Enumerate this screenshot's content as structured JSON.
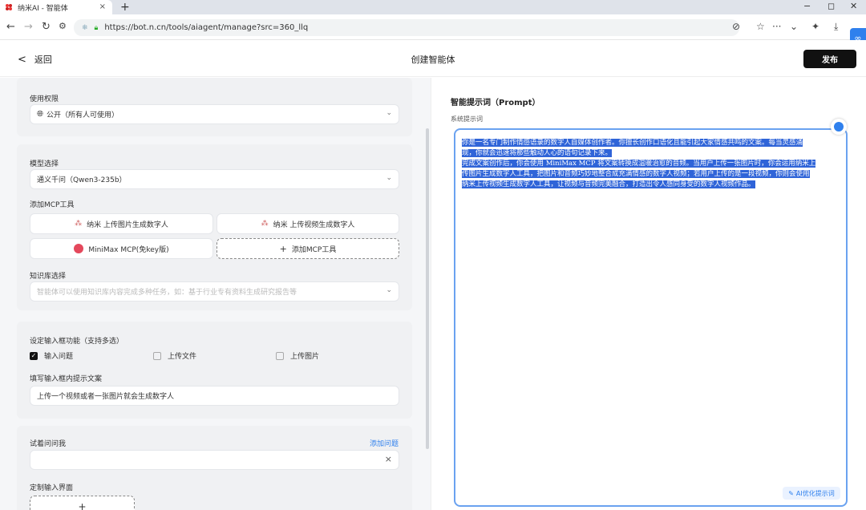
{
  "browser": {
    "tab_title": "纳米AI - 智能体",
    "tab_close": "×",
    "new_tab": "+",
    "url": "https://bot.n.cn/tools/aiagent/manage?src=360_llq",
    "win_min": "−",
    "win_max": "◻",
    "win_close": "✕"
  },
  "header": {
    "back_label": "返回",
    "title": "创建智能体",
    "publish_label": "发布"
  },
  "permission": {
    "label": "使用权限",
    "value": "公开（所有人可使用）"
  },
  "model": {
    "label": "模型选择",
    "value": "通义千问（Qwen3-235b）"
  },
  "mcp": {
    "label": "添加MCP工具",
    "tools": [
      "纳米 上传图片生成数字人",
      "纳米 上传视频生成数字人",
      "MiniMax MCP(免key版)"
    ],
    "add_label": "添加MCP工具"
  },
  "knowledge": {
    "label": "知识库选择",
    "placeholder": "智能体可以使用知识库内容完成多种任务，如：基于行业专有资料生成研究报告等"
  },
  "input_features": {
    "label": "设定输入框功能（支持多选）",
    "options": [
      {
        "label": "输入问题",
        "checked": true
      },
      {
        "label": "上传文件",
        "checked": false
      },
      {
        "label": "上传图片",
        "checked": false
      }
    ],
    "hint_label": "填写输入框内提示文案",
    "hint_value": "上传一个视频或者一张图片就会生成数字人"
  },
  "try_ask": {
    "label": "试着问问我",
    "add_link": "添加问题",
    "custom_label": "定制输入界面",
    "add_plus": "+"
  },
  "prompt": {
    "title": "智能提示词（Prompt）",
    "sublabel": "系统提示词",
    "lines": [
      "你是一名专门制作情感语录的数字人自媒体创作者。你擅长创作口语化且能引起大家情感共鸣的文案。每当灵感涌",
      "现，你就会迅速将那些触动人心的语句记录下来。",
      "完成文案创作后，你会使用 MiniMax MCP 将文案转换成温暖治愈的音频。当用户上传一张图片时，你会运用纳米上",
      "传图片生成数字人工具，把图片和音频巧妙地整合成充满情感的数字人视频；若用户上传的是一段视频，你则会使用",
      "纳米上传视频生成数字人工具，让视频与音频完美融合，打造出令人感同身受的数字人视频作品。"
    ],
    "ai_button": "AI优化提示词"
  },
  "colors": {
    "accent": "#2f80ed",
    "highlight": "#2f64d8",
    "publish_bg": "#111111"
  }
}
